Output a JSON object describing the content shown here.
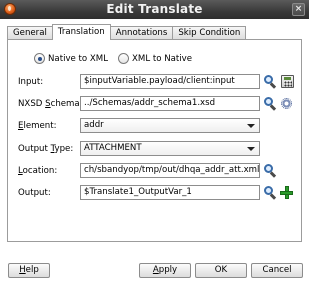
{
  "window": {
    "title": "Edit Translate",
    "close_label": "×"
  },
  "tabs": [
    {
      "label": "General"
    },
    {
      "label": "Translation"
    },
    {
      "label": "Annotations"
    },
    {
      "label": "Skip Condition"
    }
  ],
  "active_tab": "Translation",
  "direction": {
    "options": [
      {
        "label": "Native to XML",
        "checked": true
      },
      {
        "label": "XML to Native",
        "checked": false
      }
    ]
  },
  "fields": {
    "input": {
      "label": "Input:",
      "value": "$inputVariable.payload/client:input"
    },
    "nxsd_schema": {
      "label_pre": "NXSD ",
      "label_u": "S",
      "label_post": "chema:",
      "value": "../Schemas/addr_schema1.xsd"
    },
    "element": {
      "label_u": "E",
      "label_post": "lement:",
      "value": "addr"
    },
    "output_type": {
      "label_pre": "Output ",
      "label_u": "T",
      "label_post": "ype:",
      "value": "ATTACHMENT"
    },
    "location": {
      "label_u": "L",
      "label_post": "ocation:",
      "value": "ch/sbandyop/tmp/out/dhqa_addr_att.xml"
    },
    "output": {
      "label": "Output:",
      "value": "$Translate1_OutputVar_1"
    }
  },
  "buttons": {
    "help": {
      "label_u": "H",
      "label_post": "elp"
    },
    "apply": {
      "label_u": "A",
      "label_post": "pply"
    },
    "ok": {
      "label": "OK"
    },
    "cancel": {
      "label": "Cancel"
    }
  },
  "icons": {
    "app": "oracle-jdev-app-icon",
    "browse": "search-icon",
    "expression": "calculator-icon",
    "schema_settings": "gear-icon",
    "create_variable": "plus-icon"
  },
  "colors": {
    "titlebar": "#3a3a3a",
    "accent_plus": "#2a9a2a",
    "search_lens": "#3a6ca8"
  }
}
